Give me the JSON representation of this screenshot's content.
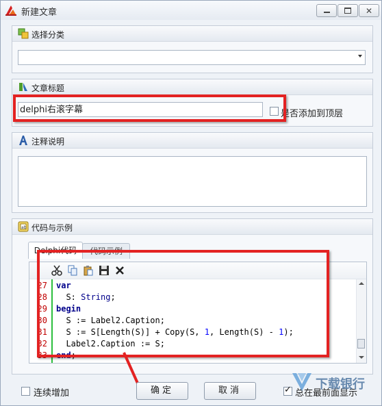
{
  "window": {
    "title": "新建文章",
    "controls": [
      "minimize",
      "maximize",
      "close"
    ]
  },
  "category_section": {
    "title": "选择分类",
    "combo_value": ""
  },
  "title_section": {
    "title": "文章标题",
    "input_value": "delphi右滚字幕",
    "pin_checkbox_label": "是否添加到顶层",
    "pin_checked": false
  },
  "notes_section": {
    "title": "注释说明",
    "text": ""
  },
  "code_section": {
    "title": "代码与示例",
    "tabs": [
      "Delphi代码",
      "代码示例"
    ],
    "active_tab": "Delphi代码",
    "toolbar": [
      "cut-icon",
      "copy-icon",
      "paste-icon",
      "save-icon",
      "delete-icon"
    ],
    "line_numbers": [
      "27",
      "28",
      "29",
      "30",
      "31",
      "32",
      "33"
    ]
  },
  "footer": {
    "continuous_add_label": "连续增加",
    "ok_label": "确定",
    "cancel_label": "取消",
    "always_on_top_label": "总在最前面显示",
    "always_on_top_checked": true
  },
  "watermark": "下载银行"
}
